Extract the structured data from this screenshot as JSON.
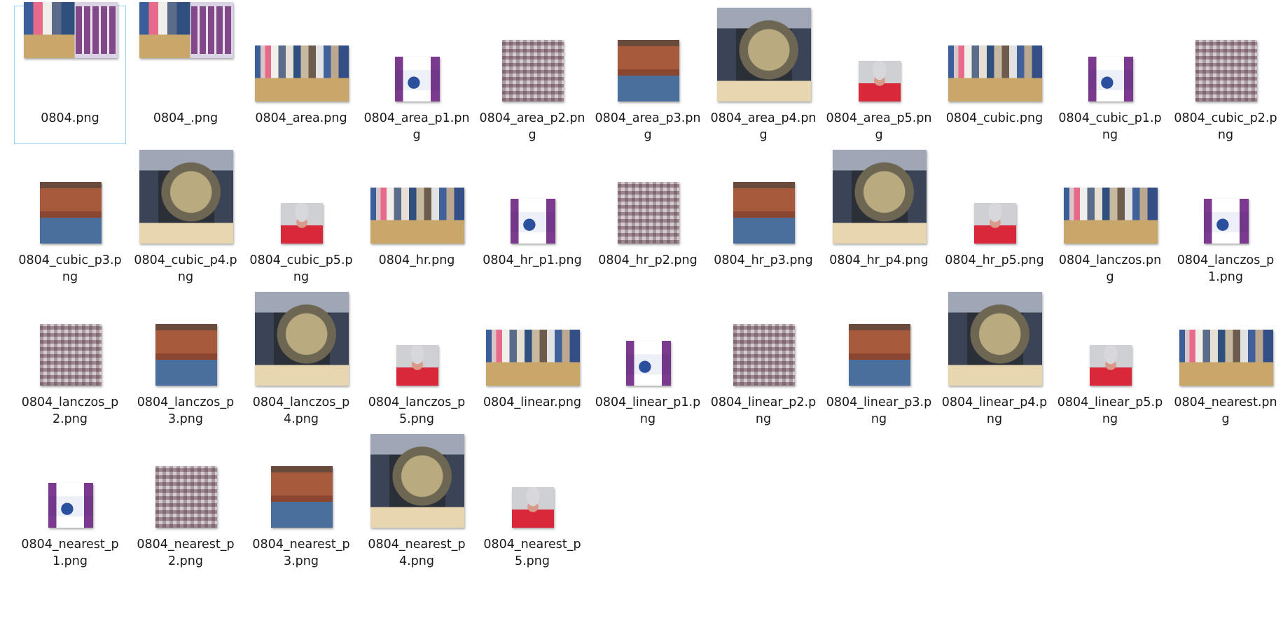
{
  "files": [
    {
      "name": "0804.png",
      "thumb": "collage",
      "size": "wide",
      "selected": true
    },
    {
      "name": "0804_.png",
      "thumb": "collage",
      "size": "wide",
      "selected": false
    },
    {
      "name": "0804_area.png",
      "thumb": "scene",
      "size": "wide",
      "selected": false
    },
    {
      "name": "0804_area_p1.png",
      "thumb": "badge",
      "size": "sm",
      "selected": false
    },
    {
      "name": "0804_area_p2.png",
      "thumb": "plaid",
      "size": "md",
      "selected": false
    },
    {
      "name": "0804_area_p3.png",
      "thumb": "belt",
      "size": "md",
      "selected": false
    },
    {
      "name": "0804_area_p4.png",
      "thumb": "buckle",
      "size": "lg",
      "selected": false
    },
    {
      "name": "0804_area_p5.png",
      "thumb": "face",
      "size": "face",
      "selected": false
    },
    {
      "name": "0804_cubic.png",
      "thumb": "scene",
      "size": "wide",
      "selected": false
    },
    {
      "name": "0804_cubic_p1.png",
      "thumb": "badge",
      "size": "sm",
      "selected": false
    },
    {
      "name": "0804_cubic_p2.png",
      "thumb": "plaid",
      "size": "md",
      "selected": false
    },
    {
      "name": "0804_cubic_p3.png",
      "thumb": "belt",
      "size": "md",
      "selected": false
    },
    {
      "name": "0804_cubic_p4.png",
      "thumb": "buckle",
      "size": "lg",
      "selected": false
    },
    {
      "name": "0804_cubic_p5.png",
      "thumb": "face",
      "size": "face",
      "selected": false
    },
    {
      "name": "0804_hr.png",
      "thumb": "scene",
      "size": "wide",
      "selected": false
    },
    {
      "name": "0804_hr_p1.png",
      "thumb": "badge",
      "size": "sm",
      "selected": false
    },
    {
      "name": "0804_hr_p2.png",
      "thumb": "plaid",
      "size": "md",
      "selected": false
    },
    {
      "name": "0804_hr_p3.png",
      "thumb": "belt",
      "size": "md",
      "selected": false
    },
    {
      "name": "0804_hr_p4.png",
      "thumb": "buckle",
      "size": "lg",
      "selected": false
    },
    {
      "name": "0804_hr_p5.png",
      "thumb": "face",
      "size": "face",
      "selected": false
    },
    {
      "name": "0804_lanczos.png",
      "thumb": "scene",
      "size": "wide",
      "selected": false
    },
    {
      "name": "0804_lanczos_p1.png",
      "thumb": "badge",
      "size": "sm",
      "selected": false
    },
    {
      "name": "0804_lanczos_p2.png",
      "thumb": "plaid",
      "size": "md",
      "selected": false
    },
    {
      "name": "0804_lanczos_p3.png",
      "thumb": "belt",
      "size": "md",
      "selected": false
    },
    {
      "name": "0804_lanczos_p4.png",
      "thumb": "buckle",
      "size": "lg",
      "selected": false
    },
    {
      "name": "0804_lanczos_p5.png",
      "thumb": "face",
      "size": "face",
      "selected": false
    },
    {
      "name": "0804_linear.png",
      "thumb": "scene",
      "size": "wide",
      "selected": false
    },
    {
      "name": "0804_linear_p1.png",
      "thumb": "badge",
      "size": "sm",
      "selected": false
    },
    {
      "name": "0804_linear_p2.png",
      "thumb": "plaid",
      "size": "md",
      "selected": false
    },
    {
      "name": "0804_linear_p3.png",
      "thumb": "belt",
      "size": "md",
      "selected": false
    },
    {
      "name": "0804_linear_p4.png",
      "thumb": "buckle",
      "size": "lg",
      "selected": false
    },
    {
      "name": "0804_linear_p5.png",
      "thumb": "face",
      "size": "face",
      "selected": false
    },
    {
      "name": "0804_nearest.png",
      "thumb": "scene",
      "size": "wide",
      "selected": false
    },
    {
      "name": "0804_nearest_p1.png",
      "thumb": "badge",
      "size": "sm",
      "selected": false
    },
    {
      "name": "0804_nearest_p2.png",
      "thumb": "plaid",
      "size": "md",
      "selected": false
    },
    {
      "name": "0804_nearest_p3.png",
      "thumb": "belt",
      "size": "md",
      "selected": false
    },
    {
      "name": "0804_nearest_p4.png",
      "thumb": "buckle",
      "size": "lg",
      "selected": false
    },
    {
      "name": "0804_nearest_p5.png",
      "thumb": "face",
      "size": "face",
      "selected": false
    }
  ],
  "colors": {
    "selection_border": "#99d1ff",
    "hover_background": "#e5f3ff",
    "label_text": "#1a1a1a",
    "window_background": "#ffffff"
  }
}
